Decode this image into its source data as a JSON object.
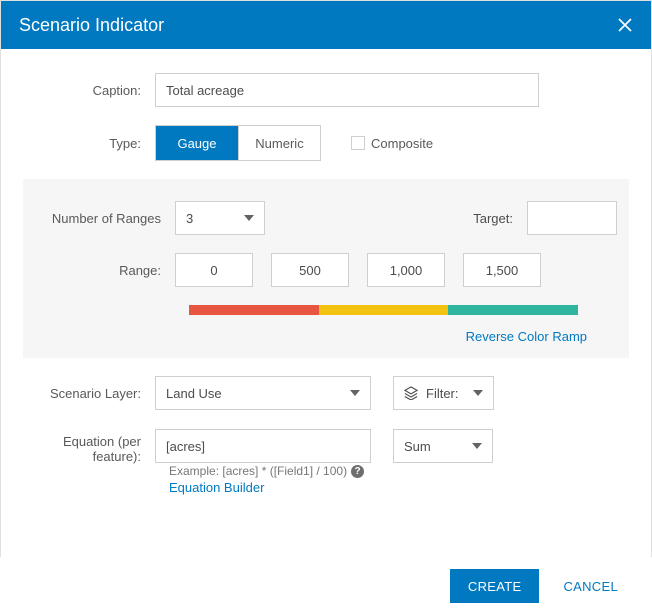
{
  "dialog": {
    "title": "Scenario Indicator"
  },
  "form": {
    "caption_label": "Caption:",
    "caption_value": "Total acreage",
    "type_label": "Type:",
    "type_gauge": "Gauge",
    "type_numeric": "Numeric",
    "composite_label": "Composite",
    "ranges": {
      "count_label": "Number of Ranges",
      "count_value": "3",
      "target_label": "Target:",
      "target_value": "",
      "range_label": "Range:",
      "stops": [
        "0",
        "500",
        "1,000",
        "1,500"
      ],
      "reverse_label": "Reverse Color Ramp",
      "colors": [
        "#e85642",
        "#f2c311",
        "#2fb59d"
      ]
    },
    "scenario": {
      "layer_label": "Scenario Layer:",
      "layer_value": "Land Use",
      "filter_label": "Filter:"
    },
    "equation": {
      "label": "Equation (per feature):",
      "value": "[acres]",
      "agg": "Sum",
      "example": "Example: [acres] * ([Field1] / 100)",
      "builder": "Equation Builder"
    }
  },
  "footer": {
    "create": "CREATE",
    "cancel": "CANCEL"
  }
}
